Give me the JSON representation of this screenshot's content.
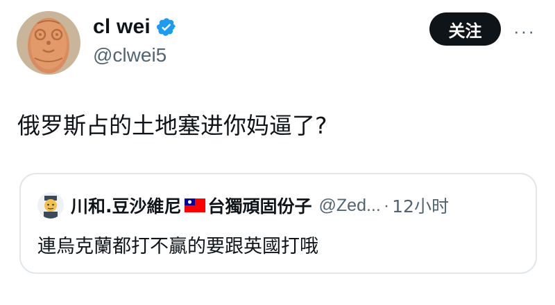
{
  "author": {
    "display_name": "cl wei",
    "handle": "@clwei5",
    "verified_icon": "verified-badge-icon",
    "avatar_icon": "carved-face-avatar"
  },
  "actions": {
    "follow_label": "关注",
    "more_label": "···"
  },
  "tweet": {
    "text": "俄罗斯占的土地塞进你妈逼了?"
  },
  "quote": {
    "name_part1": "川和.豆沙維尼",
    "flag_icon": "taiwan-flag-icon",
    "name_part2": "台獨頑固份子",
    "handle": "@Zed...",
    "separator": "·",
    "time": "12小时",
    "text": "連烏克蘭都打不贏的要跟英國打哦"
  },
  "colors": {
    "text_primary": "#0f1419",
    "text_secondary": "#536471",
    "verified_blue": "#1d9bf0",
    "button_bg": "#0f1419",
    "card_border": "#e1e6ea"
  }
}
